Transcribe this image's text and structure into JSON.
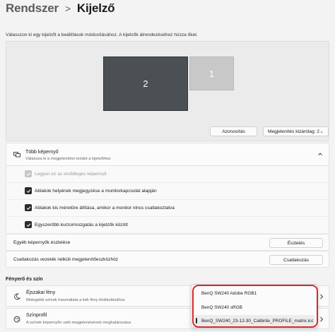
{
  "breadcrumb": {
    "parent": "Rendszer",
    "separator": ">",
    "current": "Kijelző"
  },
  "intro_text": "Válasszon ki egy kijelzőt a beállítások módosításához. A kijelzők átrendezéséhez húzza őket.",
  "arrangement": {
    "monitor_primary_label": "2",
    "monitor_secondary_label": "1",
    "identify_button": "Azonosítás",
    "display_select_value": "Megjelenítés kizárólag: 2"
  },
  "multi_display": {
    "title": "Több képernyő",
    "subtitle": "Válassza ki a megjelenítési módot a kijelzőihez",
    "options": [
      {
        "label": "Legyen ez az elsődleges képernyő",
        "checked": true,
        "disabled": true
      },
      {
        "label": "Ablakok helyének megjegyzése a monitorkapcsolat alapján",
        "checked": true,
        "disabled": false
      },
      {
        "label": "Ablakok kis méretűre állítása, amikor a monitor nincs csatlakoztatva",
        "checked": true,
        "disabled": false
      },
      {
        "label": "Egyszerűbb kurzormozgatás a kijelzők között",
        "checked": true,
        "disabled": false
      }
    ]
  },
  "detect_row": {
    "label": "Egyéb képernyők észlelése",
    "button": "Észlelés"
  },
  "wireless_row": {
    "label": "Csatlakozás vezeték nélküli megjelenítőeszközhöz",
    "button": "Csatlakozás"
  },
  "brightness_section": {
    "title": "Fényerő és szín",
    "night_light": {
      "title": "Éjszakai fény",
      "subtitle": "Melegebb színek használata a kék fény blokkolásához"
    },
    "color_profile": {
      "title": "Színprofil",
      "subtitle": "A színek képernyőn való megjelenésének meghatározása"
    }
  },
  "color_profile_dropdown": {
    "items": [
      "BenQ SW240 Adobe RGB1",
      "BenQ SW240 sRGB",
      "BenQ_SW240_23-12-30_Calibrite_PROFILE_matrix.icc"
    ],
    "selected_index": 2
  },
  "colors": {
    "accent": "#2b2b2b",
    "highlight": "#d42a2a",
    "primary_monitor": "#4a5054"
  }
}
